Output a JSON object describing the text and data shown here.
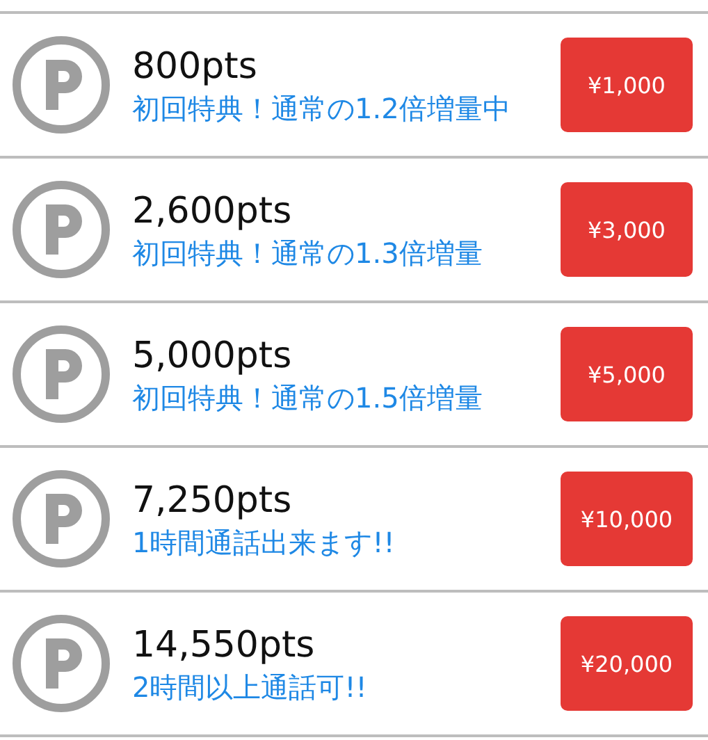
{
  "plans": [
    {
      "points": "800pts",
      "note": "初回特典！通常の1.2倍増量中",
      "price": "¥1,000"
    },
    {
      "points": "2,600pts",
      "note": "初回特典！通常の1.3倍増量",
      "price": "¥3,000"
    },
    {
      "points": "5,000pts",
      "note": "初回特典！通常の1.5倍増量",
      "price": "¥5,000"
    },
    {
      "points": "7,250pts",
      "note": "1時間通話出来ます!!",
      "price": "¥10,000"
    },
    {
      "points": "14,550pts",
      "note": "2時間以上通話可!!",
      "price": "¥20,000"
    }
  ]
}
